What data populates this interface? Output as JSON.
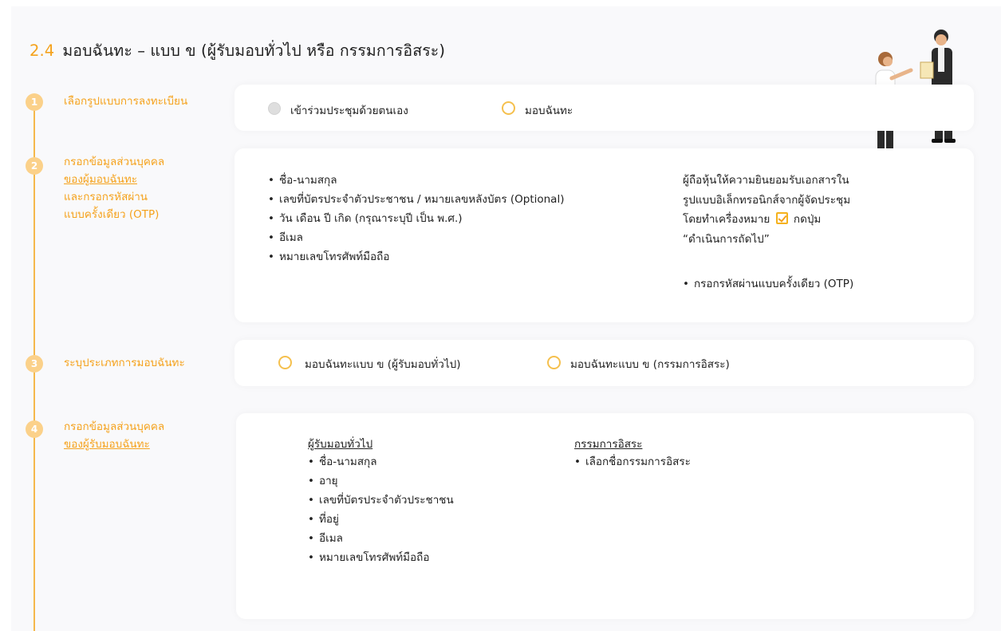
{
  "section": {
    "number": "2.4",
    "title": "มอบฉันทะ – แบบ ข (ผู้รับมอบทั่วไป หรือ กรรมการอิสระ)"
  },
  "steps": [
    {
      "number": "1",
      "label_lines": [
        "เลือกรูปแบบการลงทะเบียน"
      ]
    },
    {
      "number": "2",
      "label_lines": [
        "กรอกข้อมูลส่วนบุคคล",
        "ของผู้มอบฉันทะ",
        "และกรอกรหัสผ่าน",
        "แบบครั้งเดียว (OTP)"
      ]
    },
    {
      "number": "3",
      "label_lines": [
        "ระบุประเภทการมอบฉันทะ"
      ]
    },
    {
      "number": "4",
      "label_lines": [
        "กรอกข้อมูลส่วนบุคคล",
        "ของผู้รับมอบฉันทะ"
      ]
    }
  ],
  "step1": {
    "option_self": "เข้าร่วมประชุมด้วยตนเอง",
    "option_proxy": "มอบฉันทะ"
  },
  "step2": {
    "fields": [
      "ชื่อ-นามสกุล",
      "เลขที่บัตรประจำตัวประชาชน / หมายเลขหลังบัตร (Optional)",
      "วัน เดือน ปี เกิด (กรุณาระบุปี เป็น พ.ศ.)",
      "อีเมล",
      "หมายเลขโทรศัพท์มือถือ"
    ],
    "consent_line1": "ผู้ถือหุ้นให้ความยินยอมรับเอกสารใน",
    "consent_line2": "รูปแบบอิเล็กทรอนิกส์จากผู้จัดประชุม",
    "consent_line3_pre": "โดยทำเครื่องหมาย",
    "consent_line3_post": "กดปุ่ม",
    "consent_line4": "“ดำเนินการถัดไป”",
    "otp": "กรอกรหัสผ่านแบบครั้งเดียว (OTP)"
  },
  "step3": {
    "option_general": "มอบฉันทะแบบ ข (ผู้รับมอบทั่วไป)",
    "option_independent": "มอบฉันทะแบบ ข (กรรมการอิสระ)"
  },
  "step4": {
    "general_title": "ผู้รับมอบทั่วไป",
    "general_fields": [
      "ชื่อ-นามสกุล",
      "อายุ",
      "เลขที่บัตรประจำตัวประชาชน",
      "ที่อยู่",
      "อีเมล",
      "หมายเลขโทรศัพท์มือถือ"
    ],
    "independent_title": "กรรมการอิสระ",
    "independent_fields": [
      "เลือกชื่อกรรมการอิสระ"
    ]
  },
  "colors": {
    "accent": "#f5a21c",
    "timeline": "#f5b84b",
    "circle": "#fbd18a"
  },
  "icons": {
    "illustration": "handshake-document-illustration",
    "checkbox": "checkbox-checked-icon"
  }
}
